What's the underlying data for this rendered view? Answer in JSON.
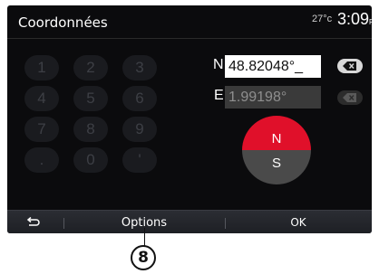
{
  "header": {
    "title": "Coordonnées",
    "temperature": "27°c",
    "time": "3:09",
    "time_suffix": "PM"
  },
  "keypad": {
    "keys": [
      "1",
      "2",
      "3",
      "4",
      "5",
      "6",
      "7",
      "8",
      "9",
      ".",
      "0",
      "'"
    ]
  },
  "coordinates": {
    "north_label": "N",
    "north_value": "48.82048°_",
    "east_label": "E",
    "east_value": "1.99198°"
  },
  "compass": {
    "north": "N",
    "south": "S",
    "active": "N",
    "active_color": "#e0102a",
    "inactive_color": "#4a4a4a"
  },
  "bottom_bar": {
    "back_icon": "back-arrow-icon",
    "options_label": "Options",
    "ok_label": "OK"
  },
  "callout": {
    "number": "8"
  },
  "colors": {
    "screen_bg": "#0b0b0d",
    "accent": "#e0102a"
  }
}
